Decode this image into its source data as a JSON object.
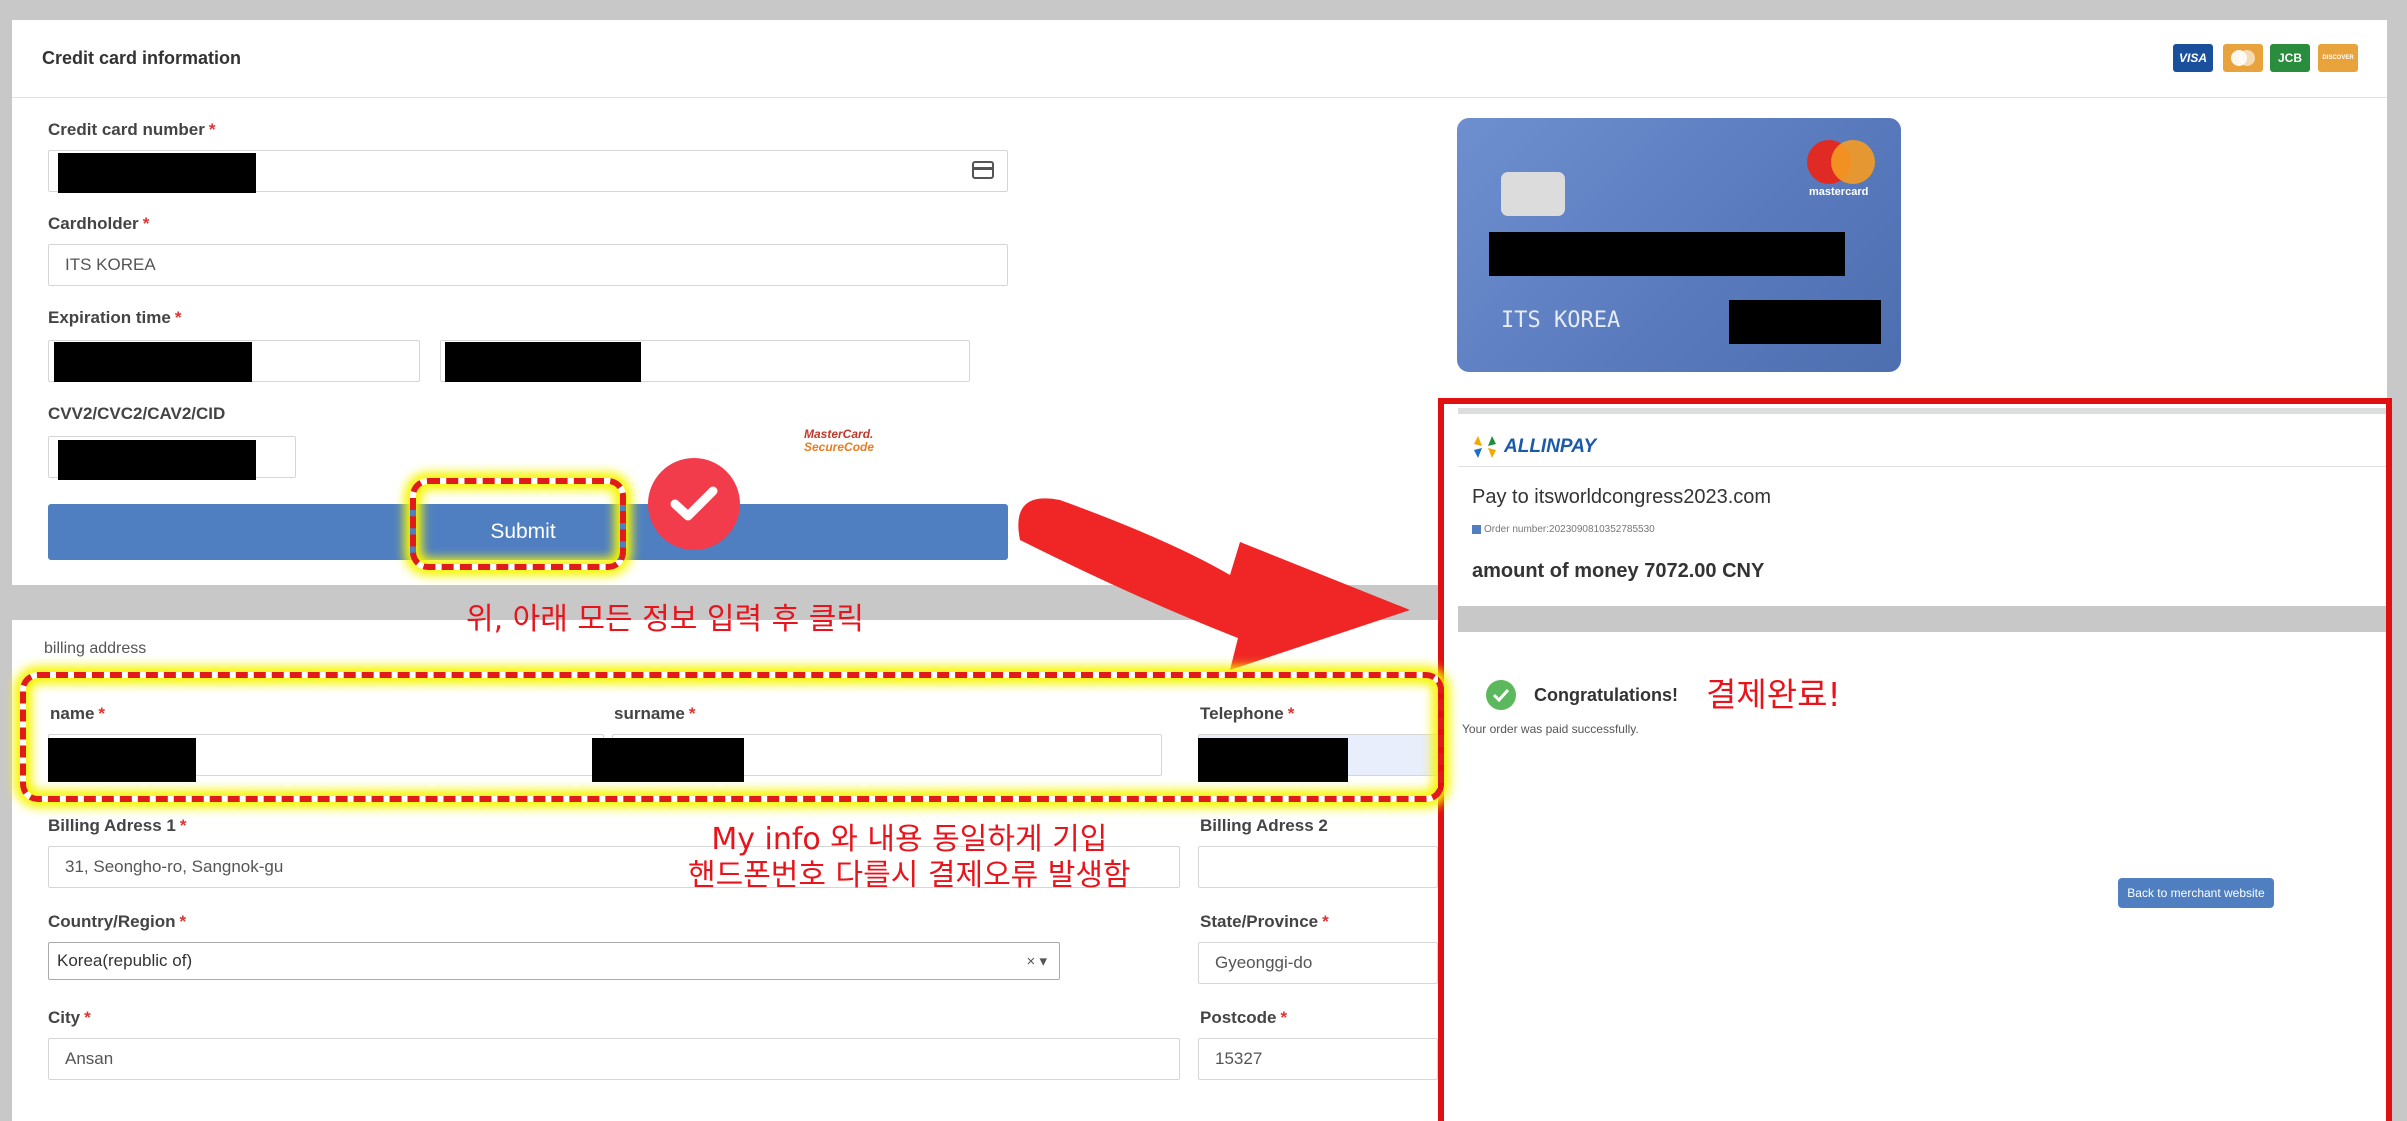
{
  "card_section": {
    "title": "Credit card information",
    "brands": [
      "VISA",
      "",
      "JCB",
      "DISCOVER"
    ],
    "card_number_label": "Credit card number",
    "cardholder_label": "Cardholder",
    "cardholder_value": "ITS KOREA",
    "expiration_label": "Expiration time",
    "cvv_label": "CVV2/CVC2/CAV2/CID",
    "securecode_line1": "MasterCard.",
    "securecode_line2": "SecureCode",
    "submit_label": "Submit",
    "required_mark": "*"
  },
  "card_preview": {
    "brand_text": "mastercard",
    "holder": "ITS KOREA"
  },
  "billing": {
    "section_label": "billing address",
    "name_label": "name",
    "surname_label": "surname",
    "telephone_label": "Telephone",
    "address1_label": "Billing Adress 1",
    "address1_value": "31, Seongho-ro, Sangnok-gu",
    "address2_label": "Billing Adress 2",
    "country_label": "Country/Region",
    "country_value": "Korea(republic of)",
    "country_clear": "× ▾",
    "state_label": "State/Province",
    "state_value": "Gyeonggi-do",
    "city_label": "City",
    "city_value": "Ansan",
    "postcode_label": "Postcode",
    "postcode_value": "15327"
  },
  "payment_result": {
    "logo_text": "ALLINPAY",
    "pay_to": "Pay to itsworldcongress2023.com",
    "order_number": "Order number:2023090810352785530",
    "amount": "amount of money 7072.00 CNY",
    "congrats": "Congratulations!",
    "paid_message": "Your order was paid successfully.",
    "back_button": "Back to merchant website"
  },
  "annotations": {
    "click_hint": "위, 아래 모든 정보 입력 후 클릭",
    "info_hint_line1": "My info 와 내용 동일하게 기입",
    "info_hint_line2": "핸드폰번호 다를시 결제오류 발생함",
    "complete": "결제완료!"
  },
  "colors": {
    "submit_blue": "#4f7fc0",
    "annotation_red": "#e8141b",
    "highlight_yellow": "#f6f600",
    "success_green": "#5cb85c"
  }
}
